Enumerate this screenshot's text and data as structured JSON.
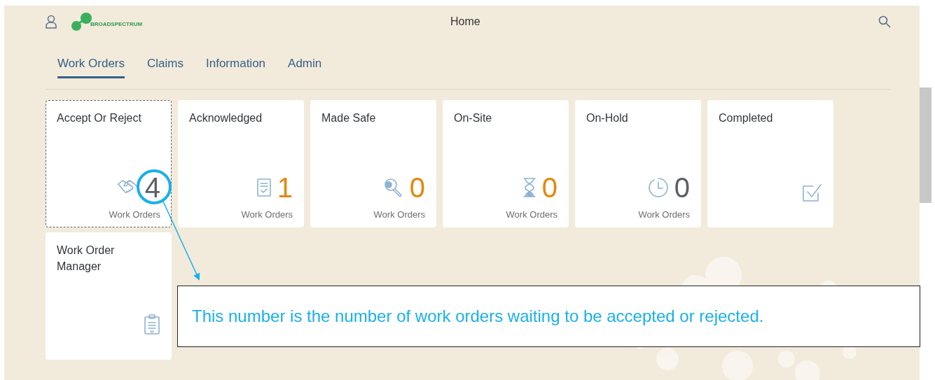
{
  "header": {
    "logo_text": "BROADSPECTRUM",
    "title": "Home"
  },
  "tabs": [
    {
      "label": "Work Orders",
      "selected": true
    },
    {
      "label": "Claims",
      "selected": false
    },
    {
      "label": "Information",
      "selected": false
    },
    {
      "label": "Admin",
      "selected": false
    }
  ],
  "tiles": [
    {
      "title": "Accept Or Reject",
      "count": "4",
      "color": "#5b6166",
      "unit": "Work Orders",
      "focused": true
    },
    {
      "title": "Acknowledged",
      "count": "1",
      "color": "#e0890f",
      "unit": "Work Orders",
      "focused": false
    },
    {
      "title": "Made Safe",
      "count": "0",
      "color": "#e0890f",
      "unit": "Work Orders",
      "focused": false
    },
    {
      "title": "On-Site",
      "count": "0",
      "color": "#e0890f",
      "unit": "Work Orders",
      "focused": false
    },
    {
      "title": "On-Hold",
      "count": "0",
      "color": "#5b6166",
      "unit": "Work Orders",
      "focused": false
    },
    {
      "title": "Completed",
      "focused": false
    },
    {
      "title": "Work Order Manager",
      "focused": false
    }
  ],
  "callout": {
    "text": "This number is the number of work orders waiting to be accepted or rejected."
  }
}
